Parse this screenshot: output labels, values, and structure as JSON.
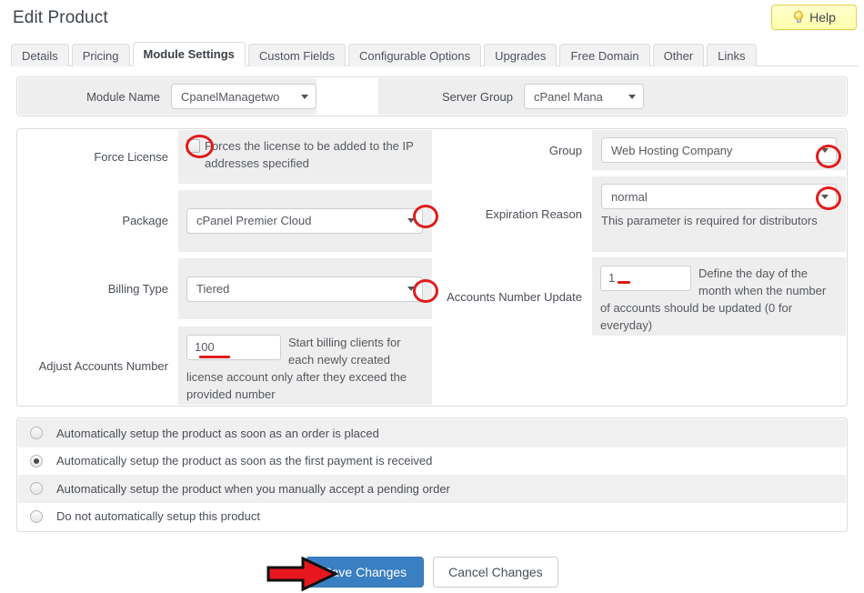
{
  "header": {
    "title": "Edit Product",
    "help_label": "Help",
    "help_icon": "lightbulb-icon"
  },
  "tabs": [
    {
      "label": "Details",
      "active": false
    },
    {
      "label": "Pricing",
      "active": false
    },
    {
      "label": "Module Settings",
      "active": true
    },
    {
      "label": "Custom Fields",
      "active": false
    },
    {
      "label": "Configurable Options",
      "active": false
    },
    {
      "label": "Upgrades",
      "active": false
    },
    {
      "label": "Free Domain",
      "active": false
    },
    {
      "label": "Other",
      "active": false
    },
    {
      "label": "Links",
      "active": false
    }
  ],
  "module_panel": {
    "module_name_label": "Module Name",
    "module_name_value": "CpanelManagetwo",
    "server_group_label": "Server Group",
    "server_group_value": "cPanel Mana"
  },
  "fields": {
    "force_license": {
      "label": "Force License",
      "checked": false,
      "description": "Forces the license to be added to the IP addresses specified"
    },
    "package": {
      "label": "Package",
      "value": "cPanel Premier Cloud"
    },
    "billing_type": {
      "label": "Billing Type",
      "value": "Tiered"
    },
    "adjust_accounts_number": {
      "label": "Adjust Accounts Number",
      "value": "100",
      "description": "Start billing clients for each newly created license account only after they exceed the provided number"
    },
    "group": {
      "label": "Group",
      "value": "Web Hosting Company"
    },
    "expiration_reason": {
      "label": "Expiration Reason",
      "value": "normal",
      "description": "This parameter is required for distributors"
    },
    "accounts_number_update": {
      "label": "Accounts Number Update",
      "value": "1",
      "description": "Define the day of the month when the number of accounts should be updated (0 for everyday)"
    }
  },
  "auto_setup": {
    "options": [
      {
        "label": "Automatically setup the product as soon as an order is placed",
        "selected": false
      },
      {
        "label": "Automatically setup the product as soon as the first payment is received",
        "selected": true
      },
      {
        "label": "Automatically setup the product when you manually accept a pending order",
        "selected": false
      },
      {
        "label": "Do not automatically setup this product",
        "selected": false
      }
    ]
  },
  "footer": {
    "save_label": "Save Changes",
    "cancel_label": "Cancel Changes"
  },
  "annotations": {
    "color": "#e01b1b",
    "items": [
      "ellipse-force-license-checkbox",
      "ellipse-package-dropdown-caret",
      "ellipse-billing-type-dropdown-caret",
      "ellipse-group-dropdown-caret",
      "ellipse-expiration-reason-dropdown-caret",
      "underline-adjust-accounts-number-value",
      "underline-accounts-number-update-value",
      "arrow-save-changes-button"
    ]
  }
}
